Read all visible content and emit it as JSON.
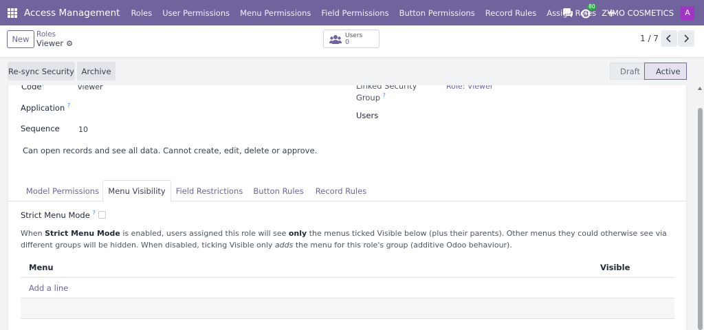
{
  "navbar": {
    "app_title": "Access Management",
    "menu": [
      "Roles",
      "User Permissions",
      "Menu Permissions",
      "Field Permissions",
      "Button Permissions",
      "Record Rules",
      "Assign Roles"
    ],
    "activity_count": "80",
    "company": "ZYMO COSMETICS",
    "avatar_letter": "A",
    "bg_color": "#71639e"
  },
  "control": {
    "new_label": "New",
    "breadcrumb_parent": "Roles",
    "breadcrumb_current": "Viewer",
    "smart_button": {
      "label": "Users",
      "value": "0"
    },
    "pager": "1 / 7"
  },
  "statusbar": {
    "actions": [
      "Re-sync Security",
      "Archive"
    ],
    "stages": [
      "Draft",
      "Active"
    ],
    "active_stage": "Active"
  },
  "form": {
    "code_label": "Code",
    "code_value": "viewer",
    "application_label": "Application",
    "sequence_label": "Sequence",
    "sequence_value": "10",
    "linked_group_label_1": "Linked Security",
    "linked_group_label_2": "Group",
    "linked_group_value": "Role: Viewer",
    "users_label": "Users",
    "description": "Can open records and see all data. Cannot create, edit, delete or approve."
  },
  "tabs": [
    "Model Permissions",
    "Menu Visibility",
    "Field Restrictions",
    "Button Rules",
    "Record Rules"
  ],
  "active_tab": "Menu Visibility",
  "menu_visibility": {
    "strict_label": "Strict Menu Mode",
    "note_p1": "When ",
    "note_b1": "Strict Menu Mode",
    "note_p2": " is enabled, users assigned this role will see ",
    "note_b2": "only",
    "note_p3": " the menus ticked Visible below (plus their parents). Other menus they could otherwise see via different groups will be hidden. When disabled, ticking Visible only ",
    "note_i1": "adds",
    "note_p4": " the menu for this role's group (additive Odoo behaviour).",
    "col_menu": "Menu",
    "col_visible": "Visible",
    "add_line": "Add a line"
  }
}
